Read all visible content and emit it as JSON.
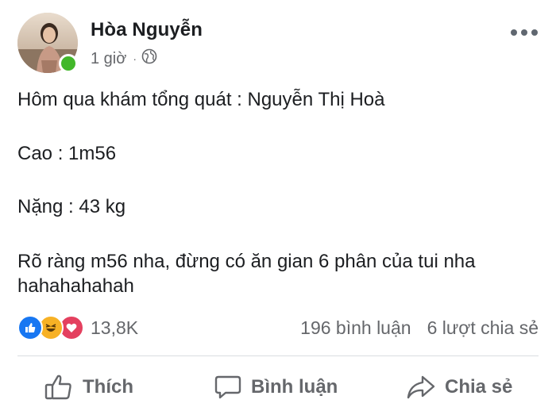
{
  "author": {
    "name": "Hòa Nguyễn",
    "online": true
  },
  "meta": {
    "time": "1 giờ",
    "separator": "·",
    "audience_icon": "globe-icon"
  },
  "post": {
    "lines": [
      "Hôm qua khám tổng quát : Nguyễn Thị Hoà",
      "Cao : 1m56",
      "Nặng : 43 kg",
      "Rõ ràng m56 nha, đừng có ăn gian 6 phân của tui nha hahahahahah"
    ]
  },
  "stats": {
    "reaction_icons": [
      "like-icon",
      "haha-icon",
      "love-icon"
    ],
    "reaction_count": "13,8K",
    "comments": "196 bình luận",
    "shares": "6 lượt chia sẻ"
  },
  "actions": {
    "like_label": "Thích",
    "comment_label": "Bình luận",
    "share_label": "Chia sẻ"
  },
  "colors": {
    "like_blue": "#1877f2",
    "haha_yellow": "#f7b125",
    "love_red": "#e4405f",
    "online_green": "#42b72a",
    "secondary_text": "#65676b"
  }
}
